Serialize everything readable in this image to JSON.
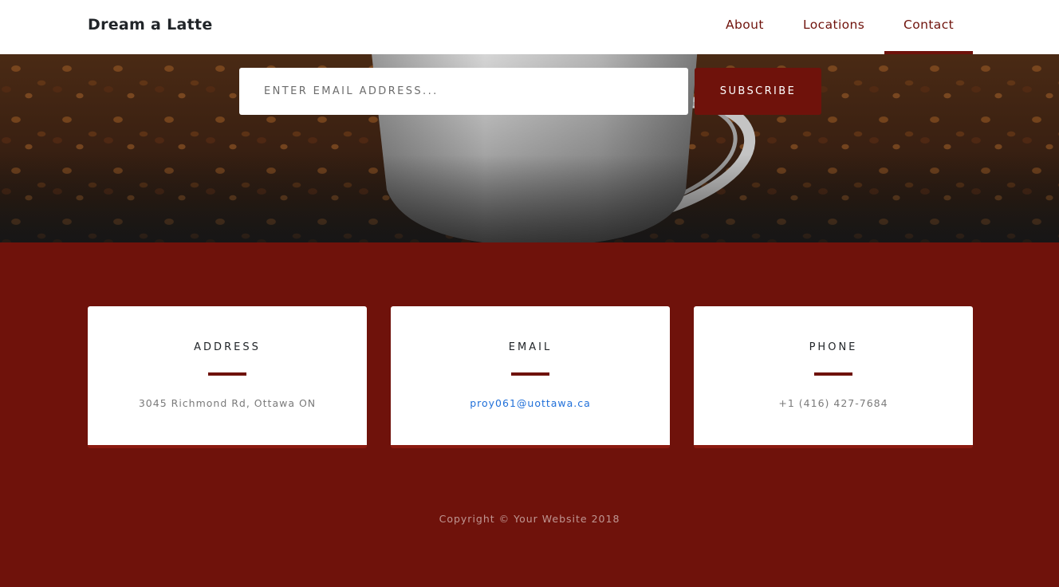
{
  "navbar": {
    "brand": "Dream a Latte",
    "links": [
      {
        "label": "About"
      },
      {
        "label": "Locations"
      },
      {
        "label": "Contact",
        "active": true
      }
    ]
  },
  "signup": {
    "email_placeholder": "ENTER EMAIL ADDRESS...",
    "email_value": "",
    "subscribe_label": "SUBSCRIBE"
  },
  "contact": {
    "address": {
      "title": "ADDRESS",
      "value": "3045 Richmond Rd, Ottawa ON"
    },
    "email": {
      "title": "EMAIL",
      "value": "proy061@uottawa.ca"
    },
    "phone": {
      "title": "PHONE",
      "value": "+1 (416) 427-7684"
    }
  },
  "footer": {
    "copyright": "Copyright © Your Website 2018"
  },
  "colors": {
    "brand_red": "#6f120b",
    "nav_bg": "#ffffff",
    "card_bg": "#ffffff",
    "link_blue": "#1f6fd9"
  },
  "icons": {
    "hero_image": "coffee-cup-on-beans"
  }
}
